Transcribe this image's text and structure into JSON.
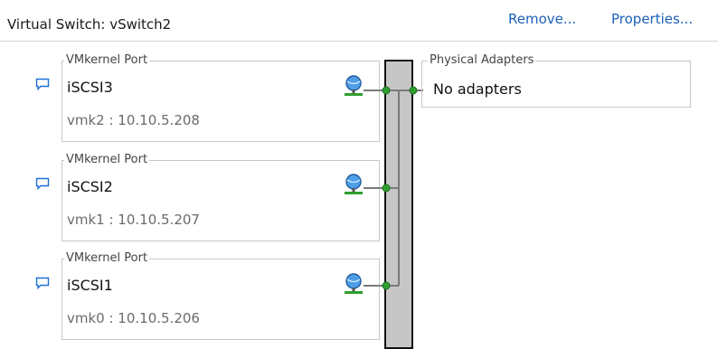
{
  "header": {
    "title": "Virtual Switch: vSwitch2",
    "remove_label": "Remove...",
    "properties_label": "Properties..."
  },
  "ports": [
    {
      "legend": "VMkernel Port",
      "name": "iSCSI3",
      "detail": "vmk2 : 10.10.5.208"
    },
    {
      "legend": "VMkernel Port",
      "name": "iSCSI2",
      "detail": "vmk1 : 10.10.5.207"
    },
    {
      "legend": "VMkernel Port",
      "name": "iSCSI1",
      "detail": "vmk0 : 10.10.5.206"
    }
  ],
  "physical": {
    "legend": "Physical Adapters",
    "status": "No adapters"
  },
  "colors": {
    "link": "#1b5fb8",
    "connector": "#2e9e2e",
    "bus_fill": "#c6c6c6"
  },
  "icons": {
    "comment": "speech-bubble-icon",
    "network": "network-globe-icon"
  }
}
